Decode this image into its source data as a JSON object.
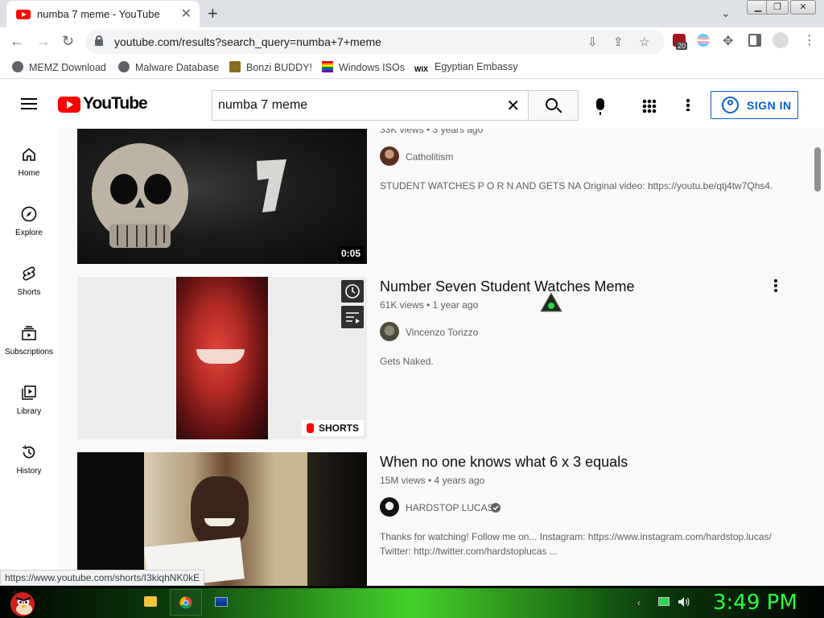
{
  "browser": {
    "tab_title": "numba 7 meme - YouTube",
    "url": "youtube.com/results?search_query=numba+7+meme",
    "extension_badge": "20",
    "bookmarks": [
      "MEMZ Download",
      "Malware Database",
      "Bonzi BUDDY!",
      "Windows ISOs",
      "Egyptian Embassy"
    ]
  },
  "youtube": {
    "logo_text": "YouTube",
    "search_query": "numba 7 meme",
    "signin_label": "SIGN IN",
    "guide": [
      {
        "label": "Home",
        "icon": "home-icon"
      },
      {
        "label": "Explore",
        "icon": "compass-icon"
      },
      {
        "label": "Shorts",
        "icon": "shorts-icon"
      },
      {
        "label": "Subscriptions",
        "icon": "subscriptions-icon"
      },
      {
        "label": "Library",
        "icon": "library-icon"
      },
      {
        "label": "History",
        "icon": "history-icon"
      }
    ],
    "results": [
      {
        "meta": "33K views • 3 years ago",
        "channel": "Catholitism",
        "description": "STUDENT WATCHES P O R N AND GETS NA Original video: https://youtu.be/qtj4tw7Qhs4.",
        "duration": "0:05"
      },
      {
        "title": "Number Seven Student Watches Meme",
        "meta": "61K views • 1 year ago",
        "channel": "Vincenzo Torizzo",
        "description": "Gets Naked.",
        "badge": "SHORTS"
      },
      {
        "title": "When no one knows what 6 x 3 equals",
        "meta": "15M views • 4 years ago",
        "channel": "HARDSTOP LUCAS",
        "verified": true,
        "description_line1": "Thanks for watching! Follow me on... Instagram: https://www.instagram.com/hardstop.lucas/",
        "description_line2": "Twitter: http://twitter.com/hardstoplucas ..."
      }
    ]
  },
  "status_url": "https://www.youtube.com/shorts/I3kiqhNK0kE",
  "taskbar": {
    "clock": "3:49 PM"
  },
  "colors": {
    "accent_blue": "#065fd4",
    "youtube_red": "#ff0000",
    "clock_green": "#27ff3a"
  }
}
